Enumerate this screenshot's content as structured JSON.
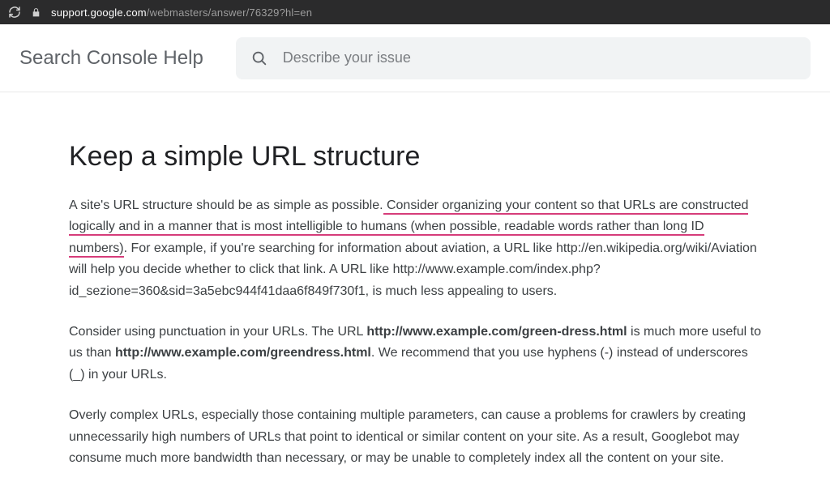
{
  "browser": {
    "url_host": "support.google.com",
    "url_path": "/webmasters/answer/76329?hl=en"
  },
  "header": {
    "site_title": "Search Console Help",
    "search_placeholder": "Describe your issue"
  },
  "article": {
    "title": "Keep a simple URL structure",
    "p1_a": "A site's URL structure should be as simple as possible.",
    "p1_u1": " Consider organizing your content so that URLs are constructed logically and in a manner that is most intelligible to humans (when possible, readable words rather than long ID numbers)",
    "p1_b": ". For example, if you're searching for information about aviation, a URL like http://en.wikipedia.org/wiki/Aviation will help you decide whether to click that link. A URL like http://www.example.com/index.php?id_sezione=360&sid=3a5ebc944f41daa6f849f730f1, is much less appealing to users.",
    "p2_a": "Consider using punctuation in your URLs. The URL ",
    "p2_b1": "http://www.example.com/green-dress.html",
    "p2_b": " is much more useful to us than ",
    "p2_b2": "http://www.example.com/greendress.html",
    "p2_c": ". We recommend that you use hyphens (-) instead of underscores (_) in your URLs.",
    "p3": "Overly complex URLs, especially those containing multiple parameters, can cause a problems for crawlers by creating unnecessarily high numbers of URLs that point to identical or similar content on your site. As a result, Googlebot may consume much more bandwidth than necessary, or may be unable to completely index all the content on your site."
  }
}
